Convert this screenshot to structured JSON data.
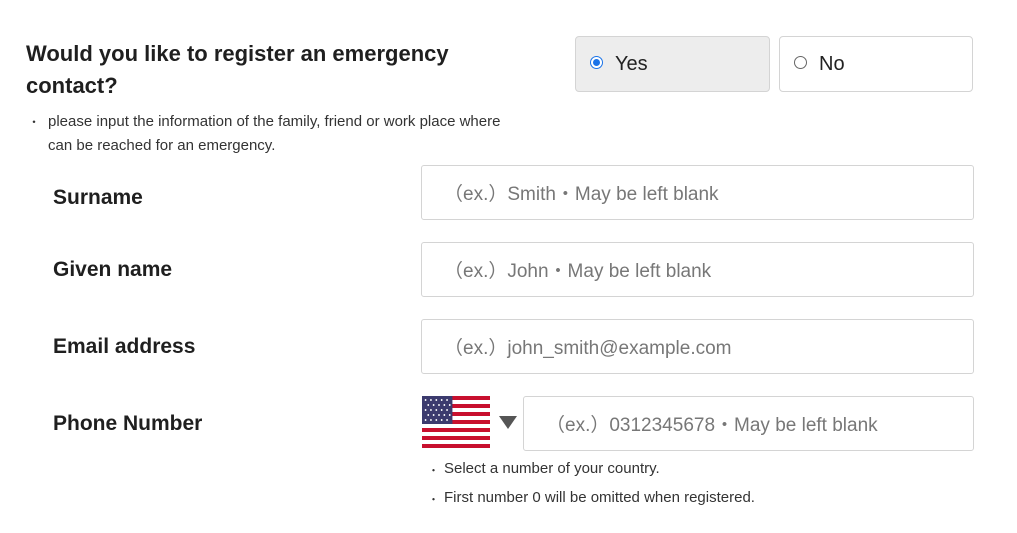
{
  "question": "Would you like to register an emergency contact?",
  "note": "please input the information of the family, friend or work place where can be reached for an emergency.",
  "bullet": "・",
  "options": {
    "yes": {
      "label": "Yes",
      "selected": true
    },
    "no": {
      "label": "No",
      "selected": false
    }
  },
  "fields": {
    "surname": {
      "label": "Surname",
      "placeholder": "（ex.）Smith・May be left blank"
    },
    "given_name": {
      "label": "Given name",
      "placeholder": "（ex.）John・May be left blank"
    },
    "email": {
      "label": "Email address",
      "placeholder": "（ex.）john_smith@example.com"
    },
    "phone": {
      "label": "Phone Number",
      "placeholder": "（ex.）0312345678・May be left blank",
      "country_flag": "us-flag-icon"
    }
  },
  "hints": [
    "Select a number of your country.",
    "First number 0 will be omitted when registered."
  ],
  "colors": {
    "radio_selected": "#1a73e8",
    "selected_option_bg": "#ededed"
  }
}
